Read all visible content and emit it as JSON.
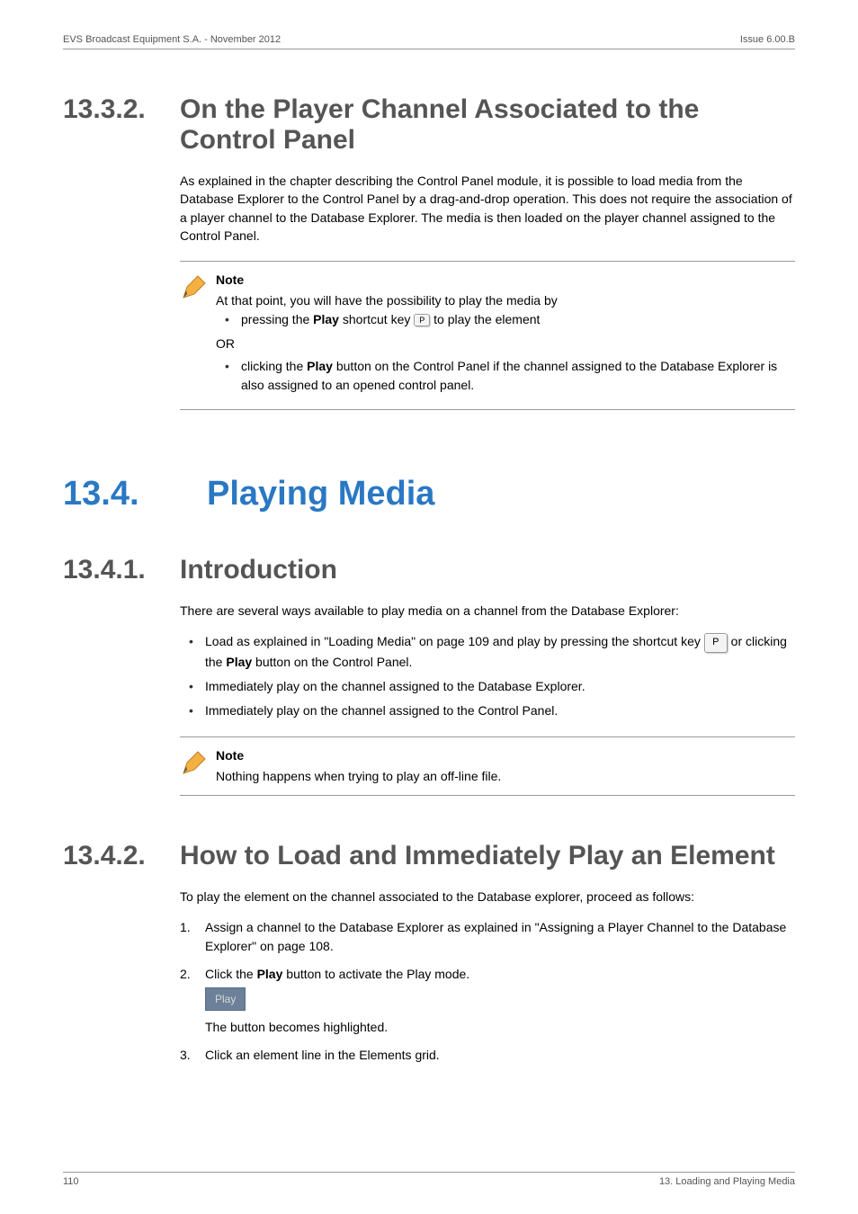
{
  "header": {
    "left": "EVS Broadcast Equipment S.A.  - November 2012",
    "right": "Issue 6.00.B"
  },
  "s1332": {
    "num": "13.3.2.",
    "title": "On the Player Channel Associated to the Control Panel",
    "body": "As explained in the chapter describing the Control Panel module, it is possible to load media from the Database Explorer to the Control Panel by a drag-and-drop operation. This does not require the association of a player channel to the Database Explorer. The media is then loaded on the player channel assigned to the Control Panel.",
    "note": {
      "title": "Note",
      "lead": "At that point, you will have the possibility to play the media by",
      "b1a": "pressing the ",
      "b1b": "Play",
      "b1c": " shortcut key ",
      "b1d": " to play the element",
      "or": "OR",
      "b2a": "clicking the ",
      "b2b": "Play",
      "b2c": " button on the Control Panel if the channel assigned to the Database Explorer is also assigned to an opened control panel."
    }
  },
  "s134": {
    "num": "13.4.",
    "title": "Playing Media"
  },
  "s1341": {
    "num": "13.4.1.",
    "title": "Introduction",
    "body": "There are several ways available to play media on a channel from the Database Explorer:",
    "b1a": "Load as explained in \"Loading Media\" on page 109 and play by pressing the shortcut key ",
    "b1b": " or clicking the ",
    "b1c": "Play",
    "b1d": " button on the Control Panel.",
    "b2": "Immediately play on the channel assigned to the Database Explorer.",
    "b3": "Immediately play on the channel assigned to the Control Panel.",
    "note": {
      "title": "Note",
      "body": "Nothing happens when trying to play an off-line file."
    }
  },
  "s1342": {
    "num": "13.4.2.",
    "title": "How to Load and Immediately Play an Element",
    "body": "To play the element on the channel associated to the Database explorer, proceed as follows:",
    "step1": "Assign a channel to the Database Explorer as explained in \"Assigning a Player Channel to the Database Explorer\" on page 108.",
    "step2a": "Click the ",
    "step2b": "Play",
    "step2c": " button to activate the Play mode.",
    "play_btn": "Play",
    "step2d": "The button becomes highlighted.",
    "step3": "Click an element line in the Elements grid."
  },
  "footer": {
    "left": "110",
    "right": "13. Loading and Playing Media"
  },
  "keys": {
    "p_small": "P",
    "p_big": "P"
  }
}
